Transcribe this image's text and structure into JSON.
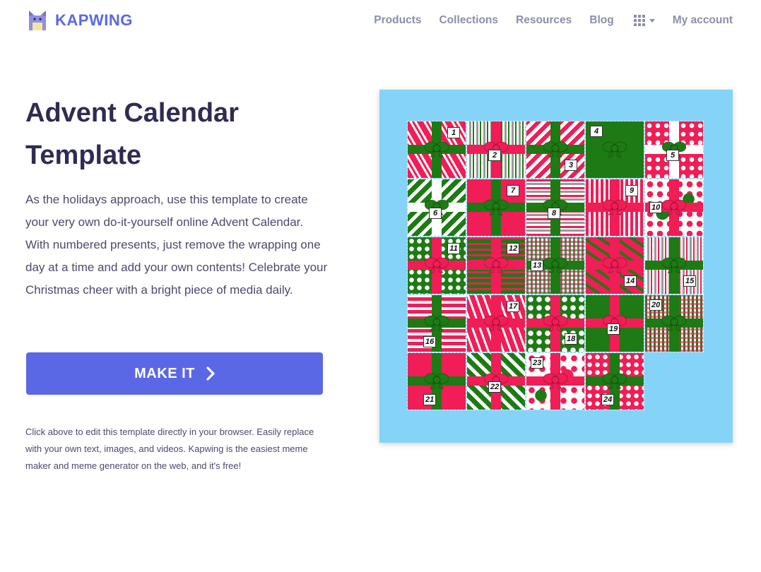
{
  "brand": {
    "name": "KAPWING",
    "color": "#5a68e6"
  },
  "nav": {
    "items": [
      {
        "label": "Products"
      },
      {
        "label": "Collections"
      },
      {
        "label": "Resources"
      },
      {
        "label": "Blog"
      }
    ],
    "apps_icon": "grid-apps-icon",
    "account": "My account"
  },
  "hero": {
    "title": "Advent Calendar Template",
    "description": "As the holidays approach, use this template to create your very own do-it-yourself online Advent Calendar. With numbered presents, just remove the wrapping one day at a time and add your own contents! Celebrate your Christmas cheer with a bright piece of media daily.",
    "cta_label": "MAKE IT",
    "cta_icon": "chevron-right-icon",
    "note": "Click above to edit this template directly in your browser. Easily replace with your own text, images, and videos. Kapwing is the easiest meme maker and meme generator on the web, and it's free!"
  },
  "preview": {
    "background": "#85d3f7",
    "red": "#f01d56",
    "green": "#1e7a14",
    "white": "#ffffff",
    "gifts": [
      {
        "num": "1",
        "bg": "red-stripes",
        "ribbon": "green",
        "corner": "tr"
      },
      {
        "num": "2",
        "bg": "gray-stripes",
        "ribbon": "red",
        "corner": "bm"
      },
      {
        "num": "3",
        "bg": "red-diag",
        "ribbon": "green",
        "corner": "br"
      },
      {
        "num": "4",
        "bg": "green",
        "ribbon": "green",
        "corner": "tl"
      },
      {
        "num": "5",
        "bg": "red-dots",
        "ribbon": "white",
        "corner": "bm"
      },
      {
        "num": "6",
        "bg": "green-diag",
        "ribbon": "white",
        "corner": "bm"
      },
      {
        "num": "7",
        "bg": "red",
        "ribbon": "green",
        "corner": "tr"
      },
      {
        "num": "8",
        "bg": "gray-hstripes",
        "ribbon": "green",
        "corner": "bm"
      },
      {
        "num": "9",
        "bg": "red-vstripes",
        "ribbon": "red",
        "corner": "tr"
      },
      {
        "num": "10",
        "bg": "green-bigdots",
        "ribbon": "red",
        "corner": "ml"
      },
      {
        "num": "11",
        "bg": "green-dots",
        "ribbon": "red",
        "corner": "tr"
      },
      {
        "num": "12",
        "bg": "green-hstripes",
        "ribbon": "red",
        "corner": "tr"
      },
      {
        "num": "13",
        "bg": "red-plaid",
        "ribbon": "green",
        "corner": "ml"
      },
      {
        "num": "14",
        "bg": "red-diag2",
        "ribbon": "red",
        "corner": "br"
      },
      {
        "num": "15",
        "bg": "gray-vstripes",
        "ribbon": "green",
        "corner": "br"
      },
      {
        "num": "16",
        "bg": "red-hstripes",
        "ribbon": "green",
        "corner": "bl"
      },
      {
        "num": "17",
        "bg": "red-diag3",
        "ribbon": "red",
        "corner": "tr"
      },
      {
        "num": "18",
        "bg": "green-dots2",
        "ribbon": "red",
        "corner": "br"
      },
      {
        "num": "19",
        "bg": "green",
        "ribbon": "red",
        "corner": "bm"
      },
      {
        "num": "20",
        "bg": "green-plaid",
        "ribbon": "green",
        "corner": "tl"
      },
      {
        "num": "21",
        "bg": "red",
        "ribbon": "green",
        "corner": "bl"
      },
      {
        "num": "22",
        "bg": "green-diag2",
        "ribbon": "red",
        "corner": "bm"
      },
      {
        "num": "23",
        "bg": "red-bigdots",
        "ribbon": "red",
        "corner": "tl"
      },
      {
        "num": "24",
        "bg": "red-dots2",
        "ribbon": "green",
        "corner": "bl"
      }
    ]
  }
}
